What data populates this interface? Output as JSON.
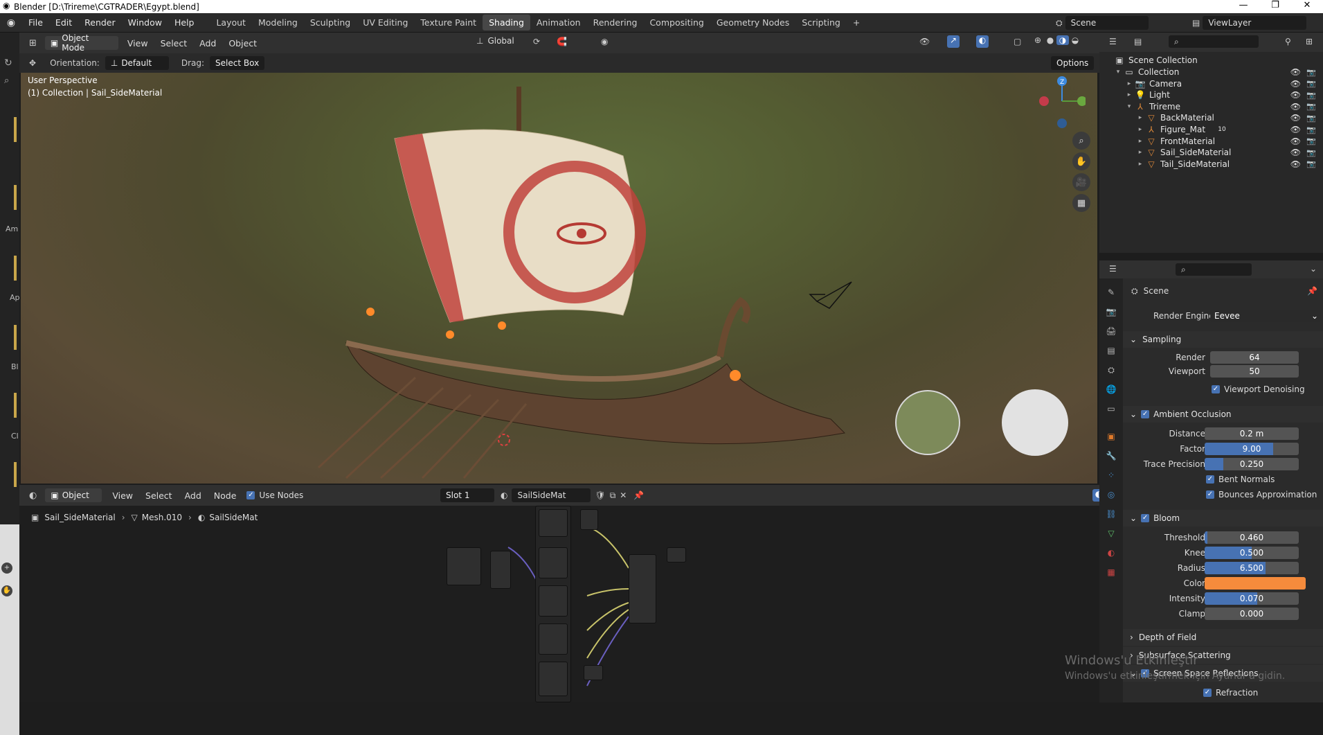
{
  "window": {
    "title": "Blender [D:\\Trireme\\CGTRADER\\Egypt.blend]",
    "min": "—",
    "restore": "❐",
    "close": "✕"
  },
  "menus": [
    "File",
    "Edit",
    "Render",
    "Window",
    "Help"
  ],
  "workspaces": [
    "Layout",
    "Modeling",
    "Sculpting",
    "UV Editing",
    "Texture Paint",
    "Shading",
    "Animation",
    "Rendering",
    "Compositing",
    "Geometry Nodes",
    "Scripting",
    "+"
  ],
  "active_workspace": "Shading",
  "scene": "Scene",
  "view_layer": "ViewLayer",
  "viewport": {
    "mode": "Object Mode",
    "menus": [
      "View",
      "Select",
      "Add",
      "Object"
    ],
    "transform": "Global",
    "orientation_label": "Orientation:",
    "orientation": "Default",
    "drag_label": "Drag:",
    "drag": "Select Box",
    "options": "Options",
    "info_line1": "User Perspective",
    "info_line2": "(1) Collection | Sail_SideMaterial"
  },
  "left_tool_labels": [
    "Am",
    "Ap",
    "Bl",
    "Cl"
  ],
  "node_editor": {
    "type": "Object",
    "menus": [
      "View",
      "Select",
      "Add",
      "Node"
    ],
    "use_nodes": "Use Nodes",
    "slot": "Slot 1",
    "material": "SailSideMat",
    "breadcrumb": [
      "Sail_SideMaterial",
      "Mesh.010",
      "SailSideMat"
    ]
  },
  "outliner": {
    "root": "Scene Collection",
    "items": [
      {
        "name": "Collection",
        "indent": 0,
        "icon": "collection-icon"
      },
      {
        "name": "Camera",
        "indent": 1,
        "icon": "camera-icon"
      },
      {
        "name": "Light",
        "indent": 1,
        "icon": "light-icon"
      },
      {
        "name": "Trireme",
        "indent": 1,
        "icon": "armature-icon"
      },
      {
        "name": "BackMaterial",
        "indent": 2,
        "icon": "mesh-icon"
      },
      {
        "name": "Figure_Mat",
        "indent": 2,
        "icon": "armature-icon",
        "badge": "10"
      },
      {
        "name": "FrontMaterial",
        "indent": 2,
        "icon": "mesh-icon"
      },
      {
        "name": "Sail_SideMaterial",
        "indent": 2,
        "icon": "mesh-icon"
      },
      {
        "name": "Tail_SideMaterial",
        "indent": 2,
        "icon": "mesh-icon"
      }
    ]
  },
  "properties": {
    "context": "Scene",
    "render_engine_label": "Render Engine",
    "render_engine": "Eevee",
    "sampling": {
      "title": "Sampling",
      "render_label": "Render",
      "render": "64",
      "viewport_label": "Viewport",
      "viewport": "50",
      "denoise": "Viewport Denoising"
    },
    "ao": {
      "title": "Ambient Occlusion",
      "distance_label": "Distance",
      "distance": "0.2 m",
      "factor_label": "Factor",
      "factor": "9.00",
      "factor_fill": 0.73,
      "trace_label": "Trace Precision",
      "trace": "0.250",
      "trace_fill": 0.2,
      "bent": "Bent Normals",
      "bounces": "Bounces Approximation"
    },
    "bloom": {
      "title": "Bloom",
      "threshold_label": "Threshold",
      "threshold": "0.460",
      "threshold_fill": 0.03,
      "knee_label": "Knee",
      "knee": "0.500",
      "knee_fill": 0.5,
      "radius_label": "Radius",
      "radius": "6.500",
      "radius_fill": 0.65,
      "color_label": "Color",
      "color": "#f58b3c",
      "intensity_label": "Intensity",
      "intensity": "0.070",
      "intensity_fill": 0.56,
      "clamp_label": "Clamp",
      "clamp": "0.000"
    },
    "dof": "Depth of Field",
    "sss": "Subsurface Scattering",
    "ssr": "Screen Space Reflections",
    "refraction": "Refraction"
  },
  "watermark": {
    "line1": "Windows'u Etkinleştir",
    "line2": "Windows'u etkinleştirmek için Ayarlar'a gidin."
  }
}
